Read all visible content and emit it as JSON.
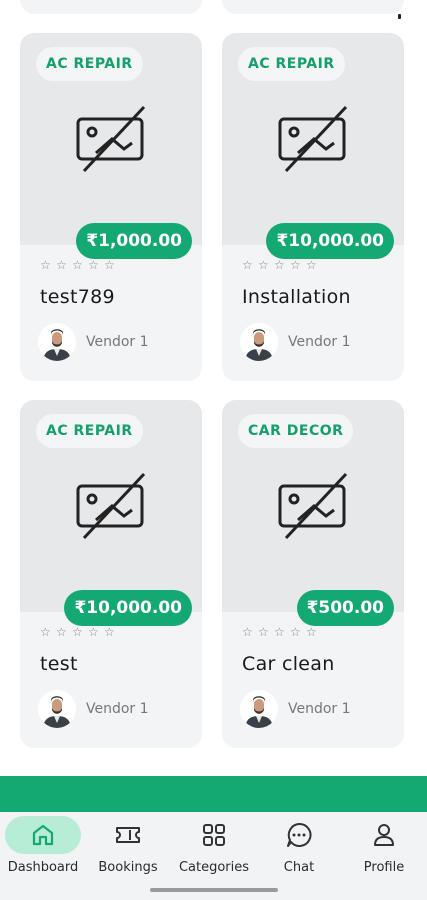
{
  "cards": [
    {
      "category": "AC REPAIR",
      "price": "₹1,000.00",
      "title": "test789",
      "vendor": "Vendor 1",
      "rating": 0,
      "max_rating": 5
    },
    {
      "category": "AC REPAIR",
      "price": "₹10,000.00",
      "title": "Installation",
      "vendor": "Vendor 1",
      "rating": 0,
      "max_rating": 5
    },
    {
      "category": "AC REPAIR",
      "price": "₹10,000.00",
      "title": "test",
      "vendor": "Vendor 1",
      "rating": 0,
      "max_rating": 5
    },
    {
      "category": "CAR DECOR",
      "price": "₹500.00",
      "title": "Car clean",
      "vendor": "Vendor 1",
      "rating": 0,
      "max_rating": 5
    }
  ],
  "nav": {
    "items": [
      {
        "label": "Dashboard",
        "icon": "home-icon",
        "active": true
      },
      {
        "label": "Bookings",
        "icon": "ticket-icon",
        "active": false
      },
      {
        "label": "Categories",
        "icon": "grid-icon",
        "active": false
      },
      {
        "label": "Chat",
        "icon": "chat-bubble-icon",
        "active": false
      },
      {
        "label": "Profile",
        "icon": "person-icon",
        "active": false
      }
    ]
  },
  "colors": {
    "accent": "#14a872",
    "badge_text": "#14a06a",
    "active_pill": "#b7ecd6"
  }
}
